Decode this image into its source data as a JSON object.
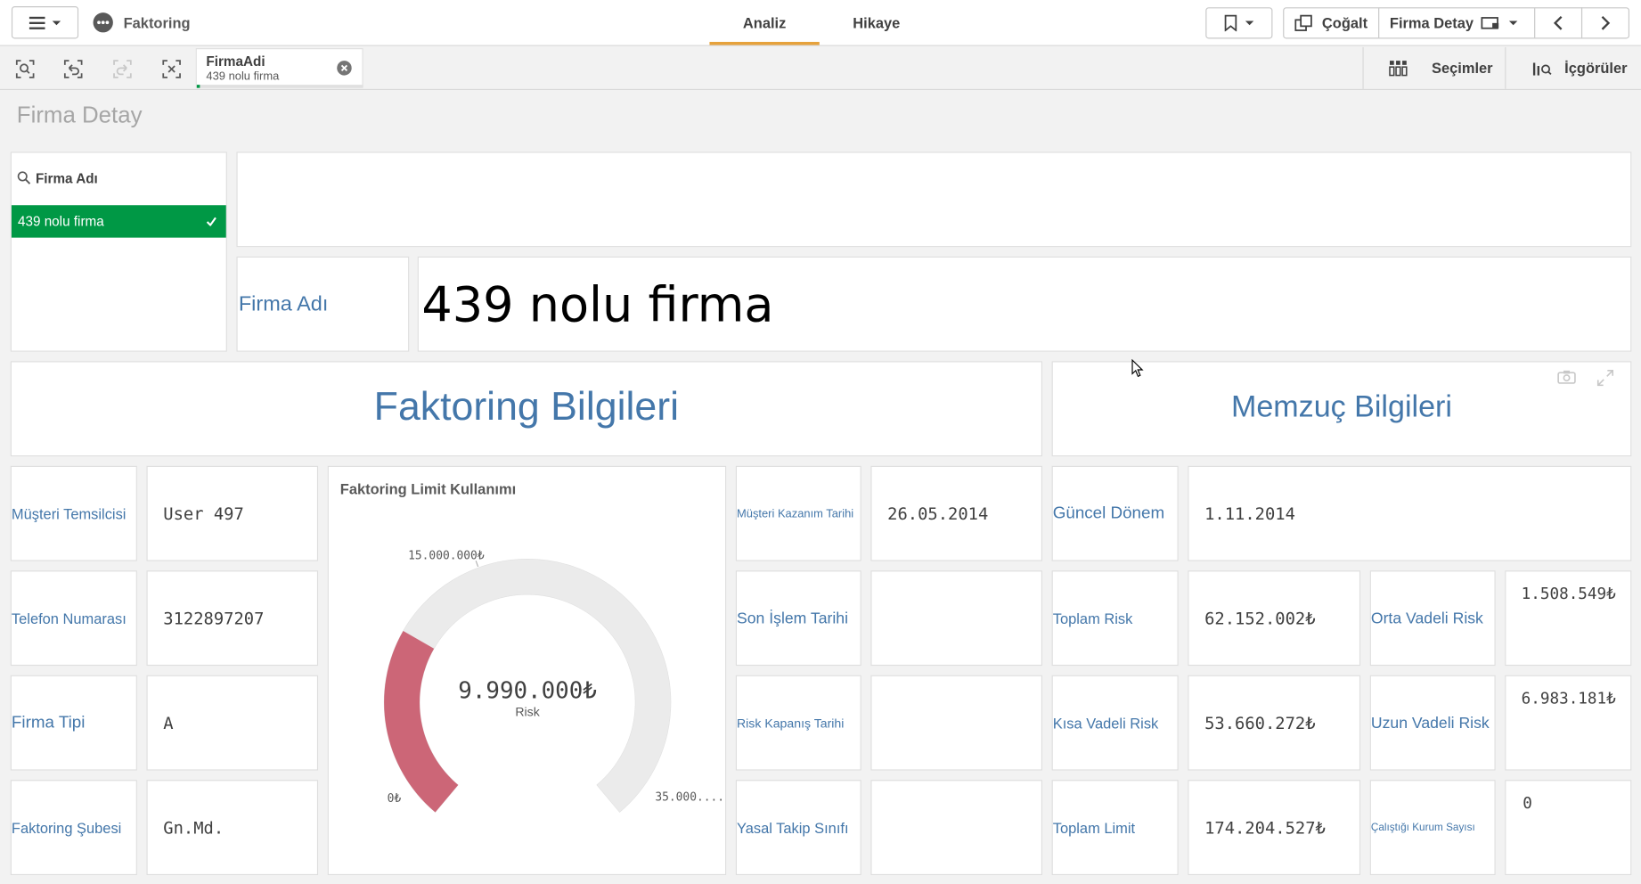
{
  "app": {
    "title": "Faktoring"
  },
  "nav": {
    "tabs": [
      "Analiz",
      "Hikaye"
    ],
    "active": "Analiz"
  },
  "toolbar": {
    "duplicate": "Çoğalt",
    "sheet": "Firma Detay"
  },
  "selection": {
    "field": "FirmaAdi",
    "value": "439 nolu firma",
    "selections_label": "Seçimler",
    "insights_label": "İçgörüler"
  },
  "sheet": {
    "title": "Firma Detay"
  },
  "listbox": {
    "title": "Firma Adı",
    "items": [
      {
        "label": "439 nolu firma",
        "selected": true
      }
    ]
  },
  "firma": {
    "label": "Firma Adı",
    "value": "439 nolu firma"
  },
  "sections": {
    "faktoring": "Faktoring Bilgileri",
    "memzuc": "Memzuç Bilgileri"
  },
  "left_fields": [
    {
      "label": "Müşteri Temsilcisi",
      "value": "User 497"
    },
    {
      "label": "Telefon Numarası",
      "value": "3122897207"
    },
    {
      "label": "Firma Tipi",
      "value": "A"
    },
    {
      "label": "Faktoring Şubesi",
      "value": "Gn.Md."
    }
  ],
  "gauge": {
    "title": "Faktoring Limit Kullanımı",
    "value_text": "9.990.000₺",
    "value_label": "Risk",
    "min_label": "0₺",
    "mark_label": "15.000.000₺",
    "max_label": "35.000....",
    "value": 9990000,
    "min": 0,
    "max": 35000000,
    "mark": 15000000,
    "color": "#cc6677"
  },
  "mid_fields": [
    {
      "label": "Müşteri Kazanım Tarihi",
      "value": "26.05.2014"
    },
    {
      "label": "Son İşlem Tarihi",
      "value": ""
    },
    {
      "label": "Risk Kapanış Tarihi",
      "value": ""
    },
    {
      "label": "Yasal Takip Sınıfı",
      "value": ""
    }
  ],
  "memzuc": {
    "guncel": {
      "label": "Güncel Dönem",
      "value": "1.11.2014"
    },
    "rows": [
      {
        "label1": "Toplam Risk",
        "value1": "62.152.002₺",
        "label2": "Orta Vadeli Risk",
        "value2": "1.508.549₺"
      },
      {
        "label1": "Kısa Vadeli Risk",
        "value1": "53.660.272₺",
        "label2": "Uzun Vadeli Risk",
        "value2": "6.983.181₺"
      },
      {
        "label1": "Toplam Limit",
        "value1": "174.204.527₺",
        "label2": "Çalıştığı Kurum Sayısı",
        "value2": "0"
      }
    ]
  }
}
